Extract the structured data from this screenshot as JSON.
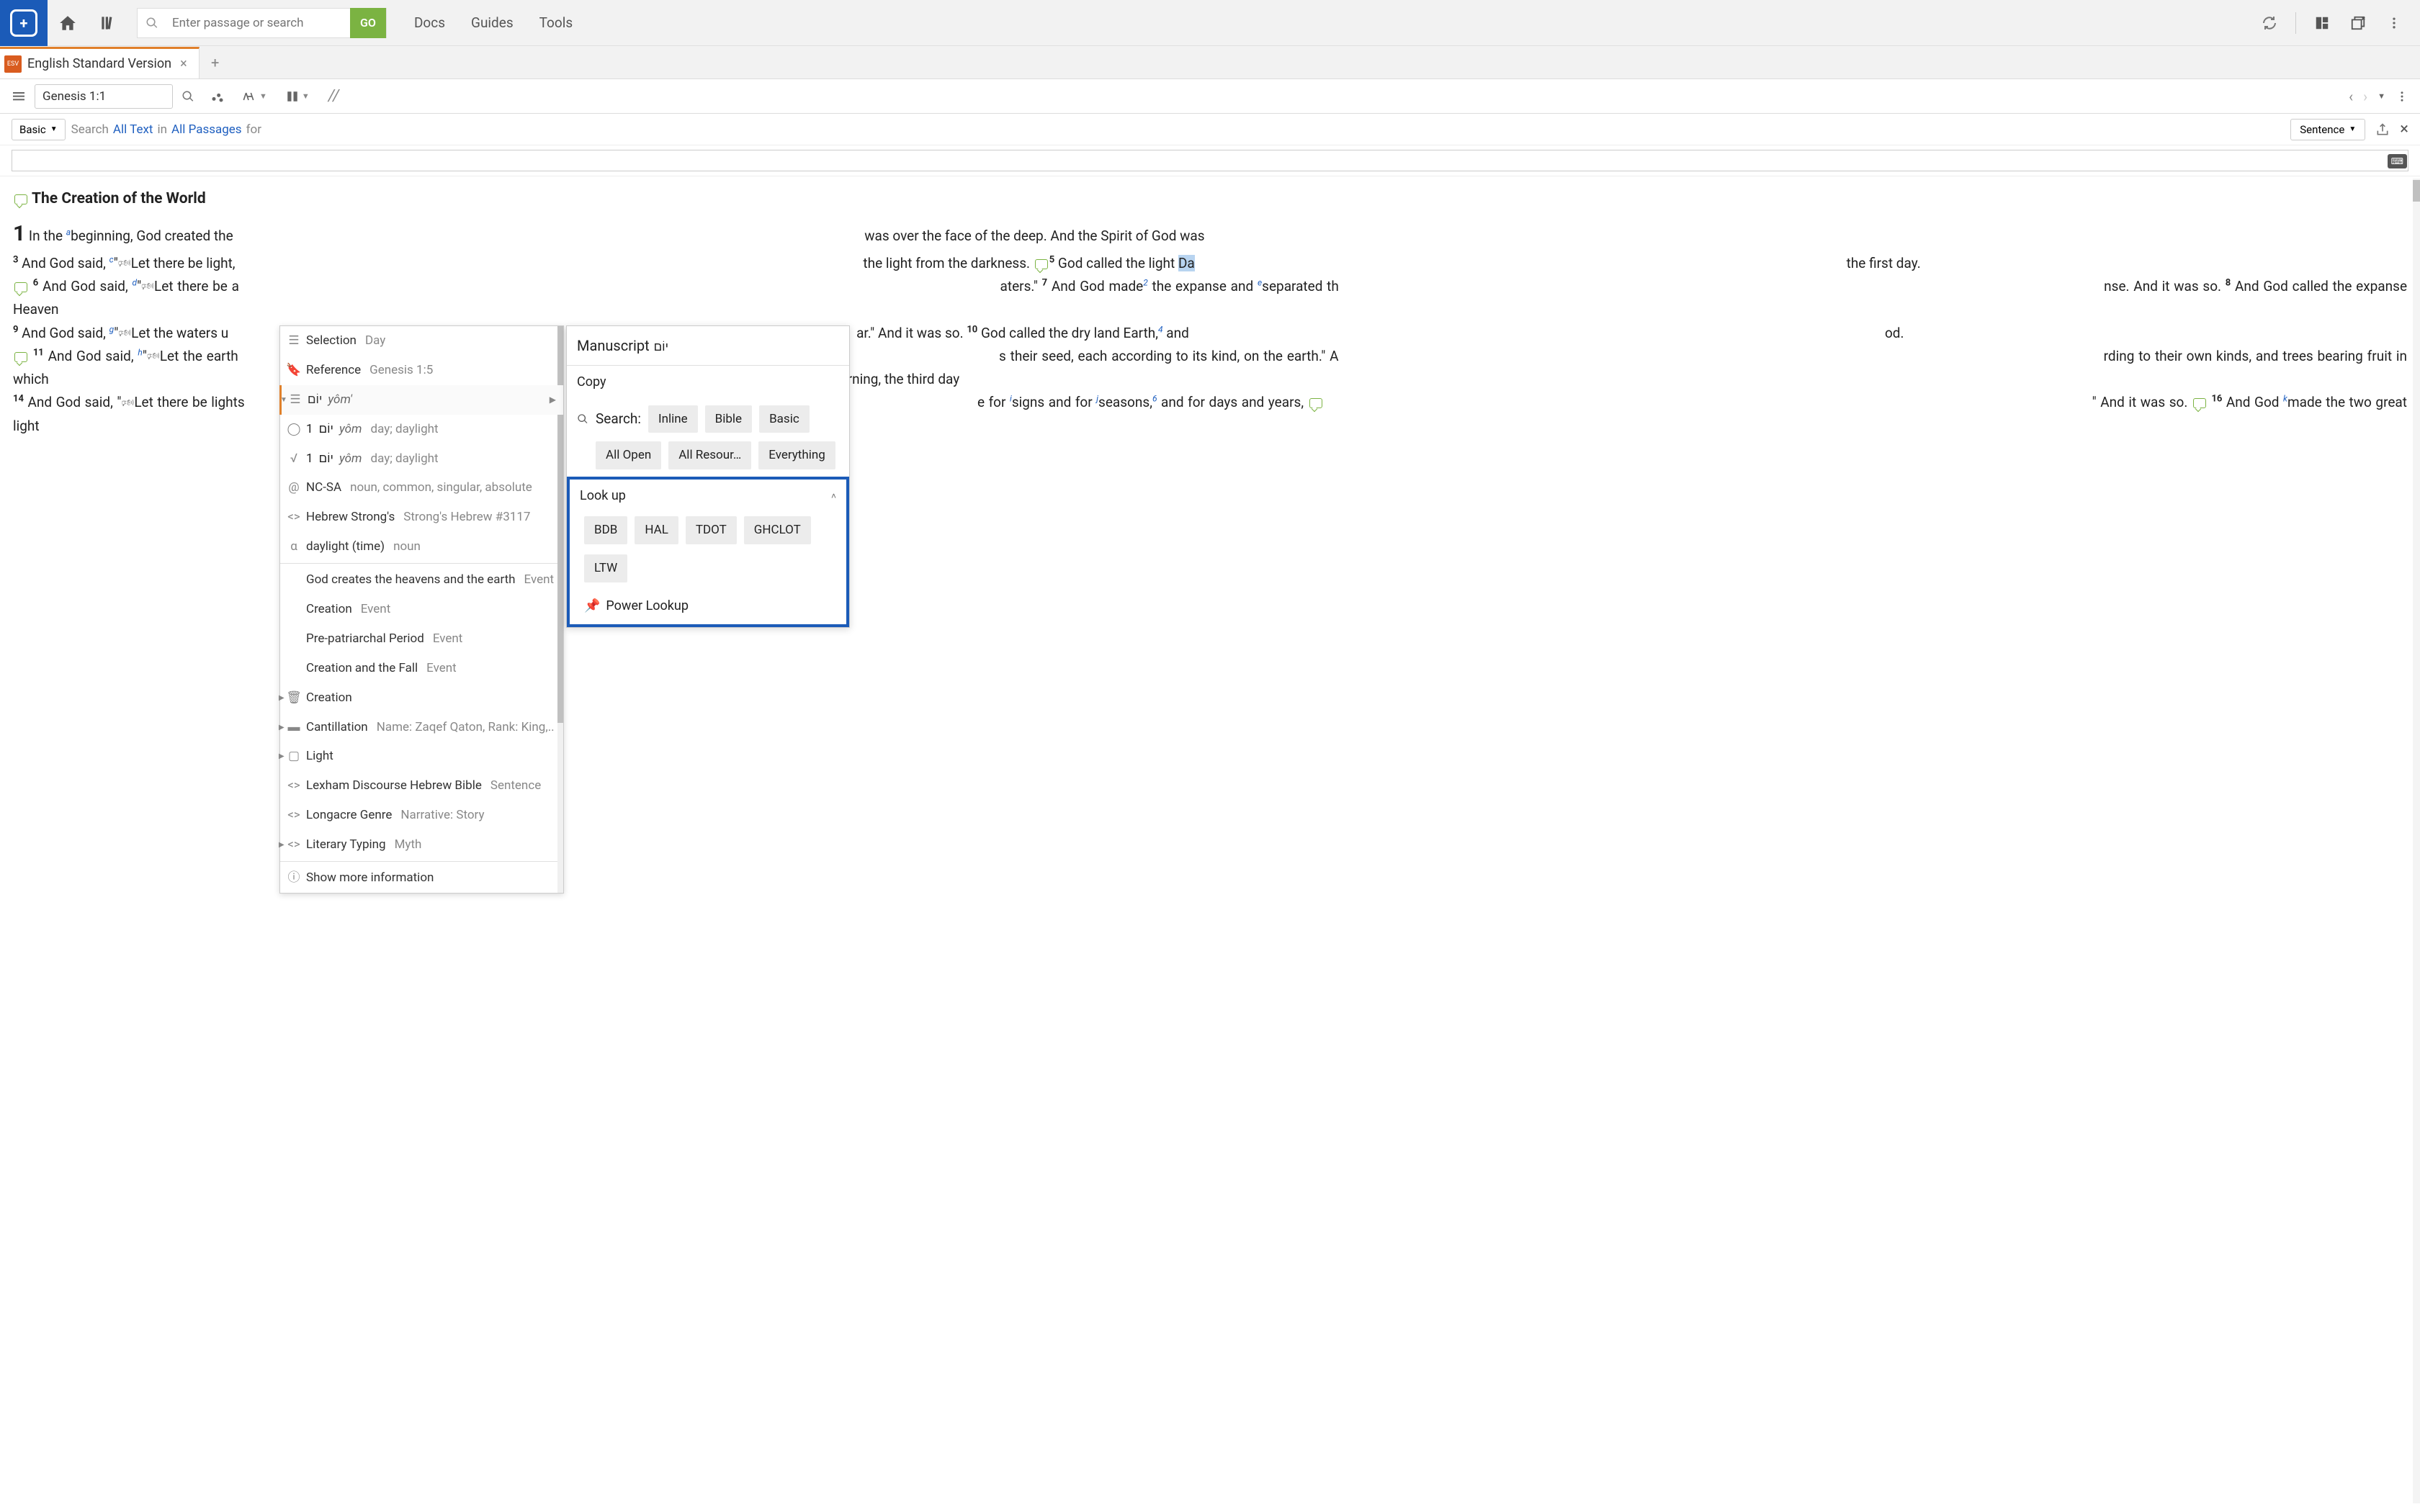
{
  "toolbar": {
    "search_placeholder": "Enter passage or search",
    "go_label": "GO",
    "menu": [
      "Docs",
      "Guides",
      "Tools"
    ]
  },
  "tab": {
    "label": "English Standard Version",
    "icon_text": "ESV"
  },
  "panel": {
    "reference": "Genesis 1:1"
  },
  "filter": {
    "basic": "Basic",
    "search_label": "Search",
    "all_text": "All Text",
    "in_label": "in",
    "all_passages": "All Passages",
    "for_label": "for",
    "sentence": "Sentence"
  },
  "content": {
    "heading": "The Creation of the World",
    "body_html": "see template"
  },
  "context_menu": {
    "selection_label": "Selection",
    "selection_value": "Day",
    "reference_label": "Reference",
    "reference_value": "Genesis 1:5",
    "lemma_hebrew": "יוֹם",
    "lemma_translit": "yôm'",
    "root1_num": "1",
    "root1_hebrew": "יוֹם",
    "root1_translit": "yôm",
    "root1_gloss": "day; daylight",
    "root2_num": "1",
    "root2_hebrew": "יוֹם",
    "root2_translit": "yôm",
    "root2_gloss": "day; daylight",
    "morph_code": "NC-SA",
    "morph_desc": "noun, common, singular, absolute",
    "strongs_label": "Hebrew Strong's",
    "strongs_value": "Strong's Hebrew #3117",
    "sense_label": "daylight (time)",
    "sense_pos": "noun",
    "event1": "God creates the heavens and the earth",
    "event1_type": "Event",
    "event2": "Creation",
    "event2_type": "Event",
    "event3": "Pre-patriarchal Period",
    "event3_type": "Event",
    "event4": "Creation and the Fall",
    "event4_type": "Event",
    "creation_label": "Creation",
    "cantillation_label": "Cantillation",
    "cantillation_value": "Name: Zaqef Qaton, Rank: King,..",
    "light_label": "Light",
    "lexham_label": "Lexham Discourse Hebrew Bible",
    "lexham_value": "Sentence",
    "longacre_label": "Longacre Genre",
    "longacre_value": "Narrative: Story",
    "literary_label": "Literary Typing",
    "literary_value": "Myth",
    "show_more": "Show more information"
  },
  "right_panel": {
    "title": "Manuscript",
    "hebrew": "יוֹם",
    "copy": "Copy",
    "search_label": "Search:",
    "search_chips": [
      "Inline",
      "Bible",
      "Basic"
    ],
    "search_chips2": [
      "All Open",
      "All Resour…",
      "Everything"
    ],
    "lookup_label": "Look up",
    "lookup_chips": [
      "BDB",
      "HAL",
      "TDOT",
      "GHCLOT"
    ],
    "lookup_chips2": [
      "LTW"
    ],
    "power_lookup": "Power Lookup"
  }
}
